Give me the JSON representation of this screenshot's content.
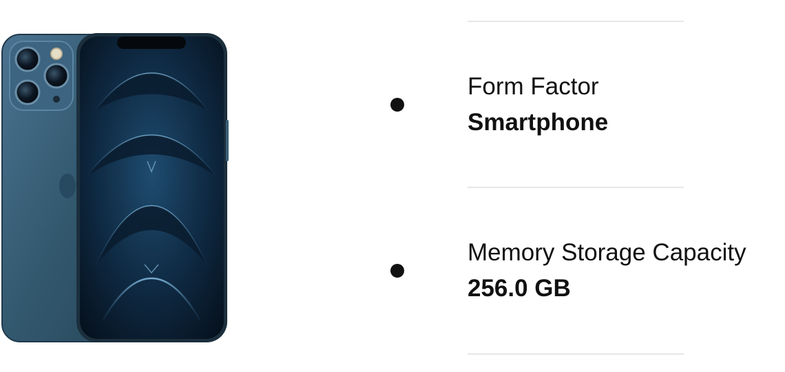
{
  "product": {
    "image_icon": "smartphone-product-image",
    "body_color": "#2f5670",
    "screen_color": "#0c1c2c"
  },
  "attributes": [
    {
      "label": "Form Factor",
      "value": "Smartphone"
    },
    {
      "label": "Memory Storage Capacity",
      "value": "256.0 GB"
    }
  ],
  "colors": {
    "text": "#111111",
    "divider": "#e7e7e7",
    "background": "#ffffff"
  }
}
